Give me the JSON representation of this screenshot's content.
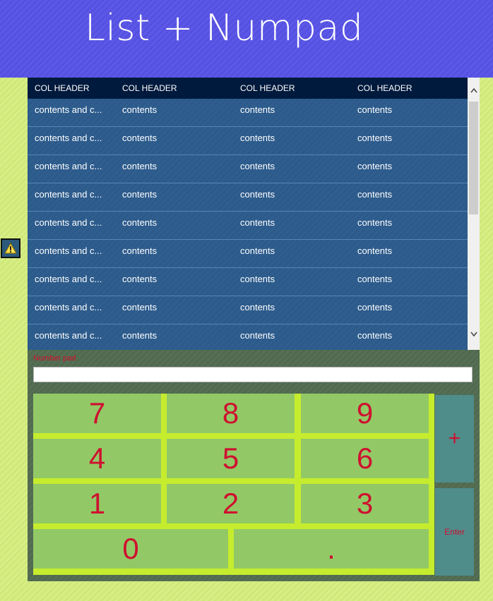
{
  "header": {
    "title": "List + Numpad"
  },
  "grid": {
    "columns": [
      "COL HEADER",
      "COL HEADER",
      "COL HEADER",
      "COL HEADER"
    ],
    "rows": [
      [
        "contents and c...",
        "contents",
        "contents",
        "contents"
      ],
      [
        "contents and c...",
        "contents",
        "contents",
        "contents"
      ],
      [
        "contents and c...",
        "contents",
        "contents",
        "contents"
      ],
      [
        "contents and c...",
        "contents",
        "contents",
        "contents"
      ],
      [
        "contents and c...",
        "contents",
        "contents",
        "contents"
      ],
      [
        "contents and c...",
        "contents",
        "contents",
        "contents"
      ],
      [
        "contents and c...",
        "contents",
        "contents",
        "contents"
      ],
      [
        "contents and c...",
        "contents",
        "contents",
        "contents"
      ],
      [
        "contents and c...",
        "contents",
        "contents",
        "contents"
      ]
    ]
  },
  "numpad": {
    "label": "Number pad",
    "input_value": "",
    "keys": {
      "k7": "7",
      "k8": "8",
      "k9": "9",
      "k4": "4",
      "k5": "5",
      "k6": "6",
      "k1": "1",
      "k2": "2",
      "k3": "3",
      "k0": "0",
      "dot": ".",
      "plus": "+",
      "enter": "Enter"
    }
  },
  "colors": {
    "background": "#d2ea7e",
    "header": "#5753e4",
    "grid_header": "#001a3d",
    "grid_row": "#2d5b8c",
    "key": "#92c966",
    "key_text": "#cf1030",
    "side_key": "#4f8d8b",
    "key_gap": "#c6ec2e"
  },
  "icons": {
    "warning": "warning-icon",
    "scroll_up": "chevron-up-icon",
    "scroll_down": "chevron-down-icon"
  }
}
